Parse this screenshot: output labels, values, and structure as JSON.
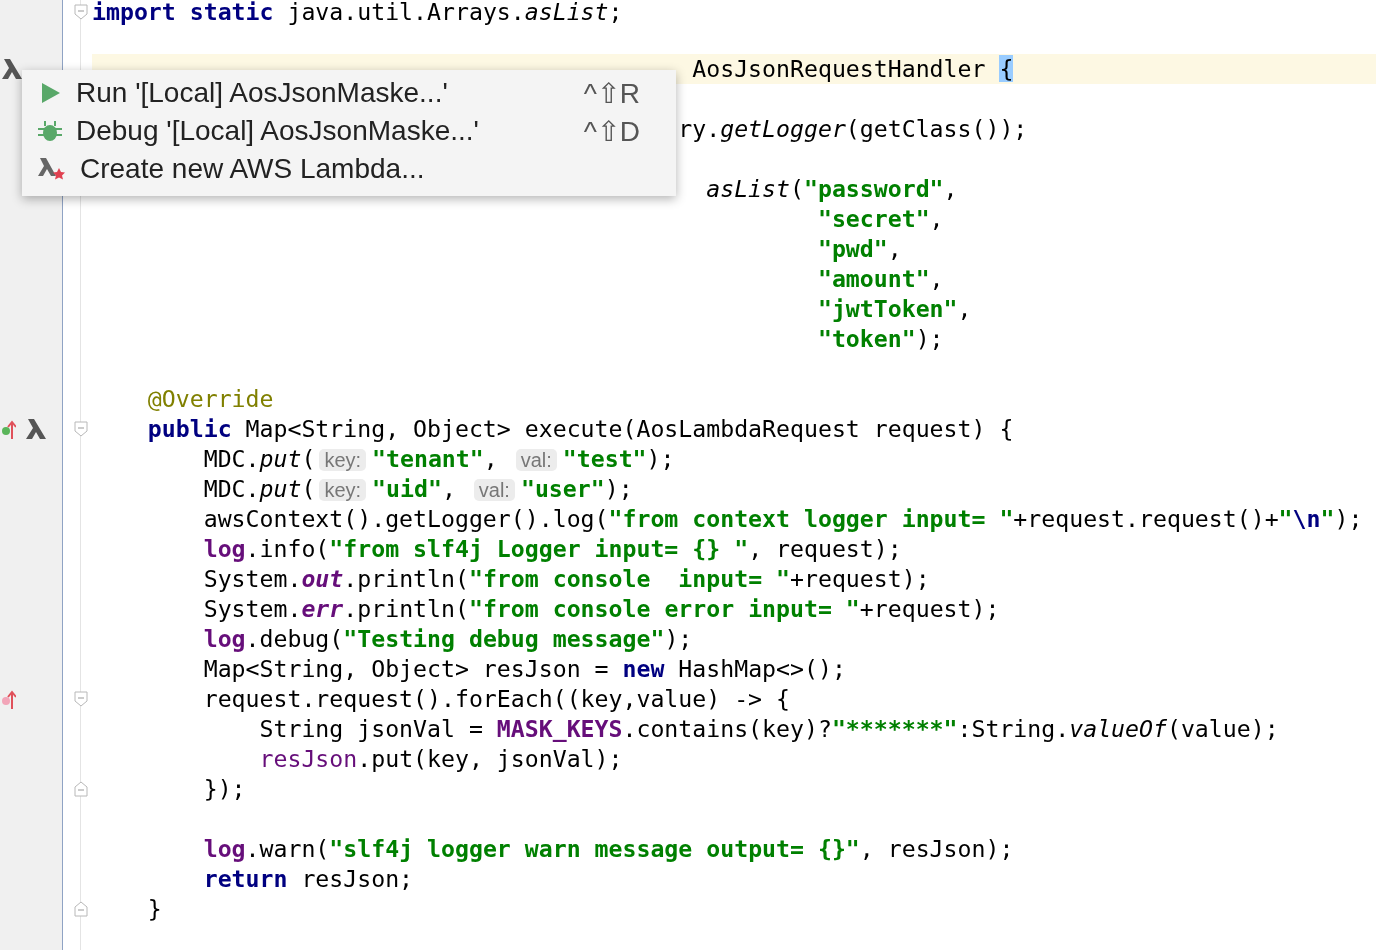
{
  "editor": {
    "lines": [
      {
        "current": false,
        "tokens": [
          {
            "text": "import static",
            "kind": "kw"
          },
          {
            "text": " java.util.Arrays.",
            "kind": "plain"
          },
          {
            "text": "asList",
            "kind": "italic"
          },
          {
            "text": ";",
            "kind": "plain"
          }
        ]
      },
      {
        "current": false
      },
      {
        "current": true,
        "tokens": [
          {
            "text": "AosJsonRequestHandler ",
            "kind": "plain"
          },
          {
            "text": "{",
            "kind": "match"
          }
        ]
      },
      {
        "current": false
      },
      {
        "current": false,
        "tokens": [
          {
            "text": "ry.",
            "kind": "plain"
          },
          {
            "text": "getLogger",
            "kind": "italic"
          },
          {
            "text": "(getClass());",
            "kind": "plain"
          }
        ]
      },
      {
        "current": false
      },
      {
        "current": false,
        "tokens": [
          {
            "text": "asList",
            "kind": "italic"
          },
          {
            "text": "(",
            "kind": "plain"
          },
          {
            "text": "\"password\"",
            "kind": "str"
          },
          {
            "text": ",",
            "kind": "plain"
          }
        ]
      },
      {
        "current": false,
        "tokens": [
          {
            "text": "\"secret\"",
            "kind": "str"
          },
          {
            "text": ",",
            "kind": "plain"
          }
        ]
      },
      {
        "current": false,
        "tokens": [
          {
            "text": "\"pwd\"",
            "kind": "str"
          },
          {
            "text": ",",
            "kind": "plain"
          }
        ]
      },
      {
        "current": false,
        "tokens": [
          {
            "text": "\"amount\"",
            "kind": "str"
          },
          {
            "text": ",",
            "kind": "plain"
          }
        ]
      },
      {
        "current": false,
        "tokens": [
          {
            "text": "\"jwtToken\"",
            "kind": "str"
          },
          {
            "text": ",",
            "kind": "plain"
          }
        ]
      },
      {
        "current": false,
        "tokens": [
          {
            "text": "\"token\"",
            "kind": "str"
          },
          {
            "text": ");",
            "kind": "plain"
          }
        ]
      },
      {
        "current": false
      },
      {
        "current": false,
        "tokens": [
          {
            "text": "@Override",
            "kind": "annotation"
          }
        ]
      },
      {
        "current": false,
        "tokens": [
          {
            "text": "public",
            "kind": "kw"
          },
          {
            "text": " Map<String, Object> execute(AosLambdaRequest request) {",
            "kind": "plain"
          }
        ]
      },
      {
        "current": false,
        "tokens": [
          {
            "text": "MDC.",
            "kind": "plain"
          },
          {
            "text": "put",
            "kind": "italic"
          },
          {
            "text": "(",
            "kind": "plain"
          },
          {
            "text": "key:",
            "kind": "hint"
          },
          {
            "text": "\"tenant\"",
            "kind": "str"
          },
          {
            "text": ", ",
            "kind": "plain"
          },
          {
            "text": "val:",
            "kind": "hint"
          },
          {
            "text": "\"test\"",
            "kind": "str"
          },
          {
            "text": ");",
            "kind": "plain"
          }
        ]
      },
      {
        "current": false,
        "tokens": [
          {
            "text": "MDC.",
            "kind": "plain"
          },
          {
            "text": "put",
            "kind": "italic"
          },
          {
            "text": "(",
            "kind": "plain"
          },
          {
            "text": "key:",
            "kind": "hint"
          },
          {
            "text": "\"uid\"",
            "kind": "str"
          },
          {
            "text": ", ",
            "kind": "plain"
          },
          {
            "text": "val:",
            "kind": "hint"
          },
          {
            "text": "\"user\"",
            "kind": "str"
          },
          {
            "text": ");",
            "kind": "plain"
          }
        ]
      },
      {
        "current": false,
        "tokens": [
          {
            "text": "awsContext().getLogger().log(",
            "kind": "plain"
          },
          {
            "text": "\"from context logger input= \"",
            "kind": "str"
          },
          {
            "text": "+request.request()+",
            "kind": "plain"
          },
          {
            "text": "\"",
            "kind": "str"
          },
          {
            "text": "\\n",
            "kind": "escape"
          },
          {
            "text": "\"",
            "kind": "str"
          },
          {
            "text": ");",
            "kind": "plain"
          }
        ]
      },
      {
        "current": false,
        "tokens": [
          {
            "text": "log",
            "kind": "field"
          },
          {
            "text": ".info(",
            "kind": "plain"
          },
          {
            "text": "\"from slf4j Logger input= {} \"",
            "kind": "str"
          },
          {
            "text": ", request);",
            "kind": "plain"
          }
        ]
      },
      {
        "current": false,
        "tokens": [
          {
            "text": "System.",
            "kind": "plain"
          },
          {
            "text": "out",
            "kind": "field_italic"
          },
          {
            "text": ".println(",
            "kind": "plain"
          },
          {
            "text": "\"from console  input= \"",
            "kind": "str"
          },
          {
            "text": "+request);",
            "kind": "plain"
          }
        ]
      },
      {
        "current": false,
        "tokens": [
          {
            "text": "System.",
            "kind": "plain"
          },
          {
            "text": "err",
            "kind": "field_italic"
          },
          {
            "text": ".println(",
            "kind": "plain"
          },
          {
            "text": "\"from console error input= \"",
            "kind": "str"
          },
          {
            "text": "+request);",
            "kind": "plain"
          }
        ]
      },
      {
        "current": false,
        "tokens": [
          {
            "text": "log",
            "kind": "field"
          },
          {
            "text": ".debug(",
            "kind": "plain"
          },
          {
            "text": "\"Testing debug message\"",
            "kind": "str"
          },
          {
            "text": ");",
            "kind": "plain"
          }
        ]
      },
      {
        "current": false,
        "tokens": [
          {
            "text": "Map<String, Object> resJson = ",
            "kind": "plain"
          },
          {
            "text": "new",
            "kind": "kw"
          },
          {
            "text": " HashMap<>();",
            "kind": "plain"
          }
        ]
      },
      {
        "current": false,
        "tokens": [
          {
            "text": "request.request().forEach((key,value) -> {",
            "kind": "plain"
          }
        ]
      },
      {
        "current": false,
        "tokens": [
          {
            "text": "String jsonVal = ",
            "kind": "plain"
          },
          {
            "text": "MASK_KEYS",
            "kind": "field"
          },
          {
            "text": ".contains(key)?",
            "kind": "plain"
          },
          {
            "text": "\"*******\"",
            "kind": "str"
          },
          {
            "text": ":String.",
            "kind": "plain"
          },
          {
            "text": "valueOf",
            "kind": "italic"
          },
          {
            "text": "(value);",
            "kind": "plain"
          }
        ]
      },
      {
        "current": false,
        "tokens": [
          {
            "text": "resJson",
            "kind": "local"
          },
          {
            "text": ".put(key, jsonVal);",
            "kind": "plain"
          }
        ]
      },
      {
        "current": false,
        "tokens": [
          {
            "text": "});",
            "kind": "plain"
          }
        ]
      },
      {
        "current": false
      },
      {
        "current": false,
        "tokens": [
          {
            "text": "log",
            "kind": "field"
          },
          {
            "text": ".warn(",
            "kind": "plain"
          },
          {
            "text": "\"slf4j logger warn message output= {}\"",
            "kind": "str"
          },
          {
            "text": ", resJson);",
            "kind": "plain"
          }
        ]
      },
      {
        "current": false,
        "tokens": [
          {
            "text": "return",
            "kind": "kw"
          },
          {
            "text": " resJson;",
            "kind": "plain"
          }
        ]
      },
      {
        "current": false,
        "tokens": [
          {
            "text": "}",
            "kind": "plain"
          }
        ]
      }
    ]
  },
  "popup_menu": {
    "items": [
      {
        "label": "Run '[Local] AosJsonMaske...'",
        "shortcut": "^⇧R",
        "selected": false
      },
      {
        "label": "Debug '[Local] AosJsonMaske...'",
        "shortcut": "^⇧D",
        "selected": false
      },
      {
        "label": "Create new AWS Lambda...",
        "selected": false
      }
    ]
  }
}
